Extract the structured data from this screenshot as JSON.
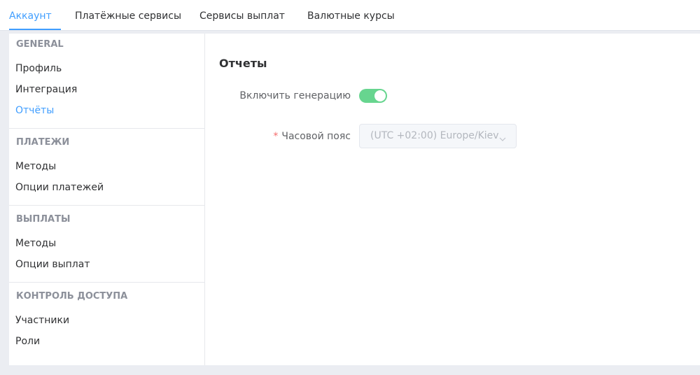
{
  "tabs": [
    {
      "label": "Аккаунт",
      "active": true
    },
    {
      "label": "Платёжные сервисы",
      "active": false
    },
    {
      "label": "Сервисы выплат",
      "active": false
    },
    {
      "label": "Валютные курсы",
      "active": false
    }
  ],
  "sidebar": {
    "sections": [
      {
        "heading": "GENERAL",
        "items": [
          "Профиль",
          "Интеграция",
          "Отчёты"
        ]
      },
      {
        "heading": "ПЛАТЕЖИ",
        "items": [
          "Методы",
          "Опции платежей"
        ]
      },
      {
        "heading": "ВЫПЛАТЫ",
        "items": [
          "Методы",
          "Опции выплат"
        ]
      },
      {
        "heading": "КОНТРОЛЬ ДОСТУПА",
        "items": [
          "Участники",
          "Роли"
        ]
      }
    ],
    "active_item": "Отчёты"
  },
  "main": {
    "title": "Отчеты",
    "enable_generation": {
      "label": "Включить генерацию",
      "enabled": true
    },
    "timezone": {
      "required_mark": "*",
      "label": "Часовой пояс",
      "value": "(UTC +02:00) Europe/Kiev",
      "disabled": true
    }
  },
  "colors": {
    "accent": "#409eff",
    "switch_on": "#67d58f",
    "required": "#f56c6c",
    "page_background": "#ebedf2"
  },
  "icons": {
    "select_arrow": "chevron-down-icon"
  }
}
